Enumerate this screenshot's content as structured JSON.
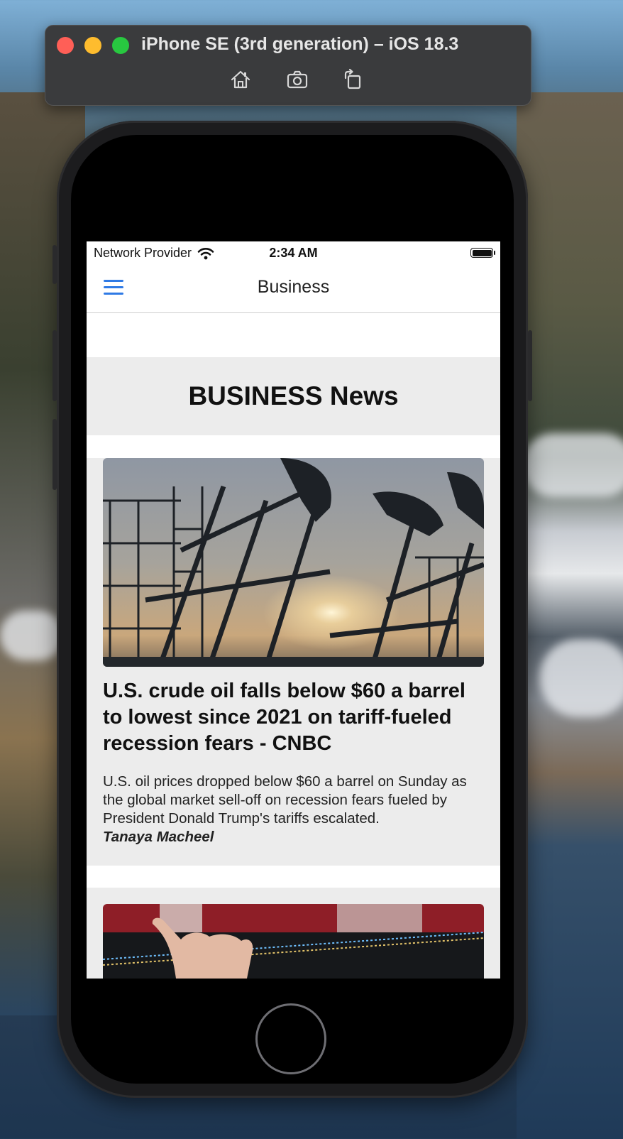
{
  "simulator": {
    "title": "iPhone SE (3rd generation) – iOS 18.3",
    "buttons": [
      "home-icon",
      "screenshot-camera-icon",
      "rotate-icon"
    ]
  },
  "status_bar": {
    "carrier": "Network Provider",
    "time": "2:34 AM"
  },
  "nav": {
    "title": "Business"
  },
  "section": {
    "title": "BUSINESS News"
  },
  "articles": [
    {
      "image": "oil-pumpjacks-sunset-photo",
      "headline": "U.S. crude oil falls below $60 a barrel to lowest since 2021 on tariff-fueled recession fears - CNBC",
      "description": "U.S. oil prices dropped below $60 a barrel on Sunday as the global market sell-off on recession fears fueled by President Donald Trump's tariffs escalated.",
      "author": "Tanaya Macheel"
    },
    {
      "image": "hand-holding-sign-photo"
    }
  ],
  "colors": {
    "accent": "#2f7ae5",
    "card_bg": "#ececec"
  }
}
